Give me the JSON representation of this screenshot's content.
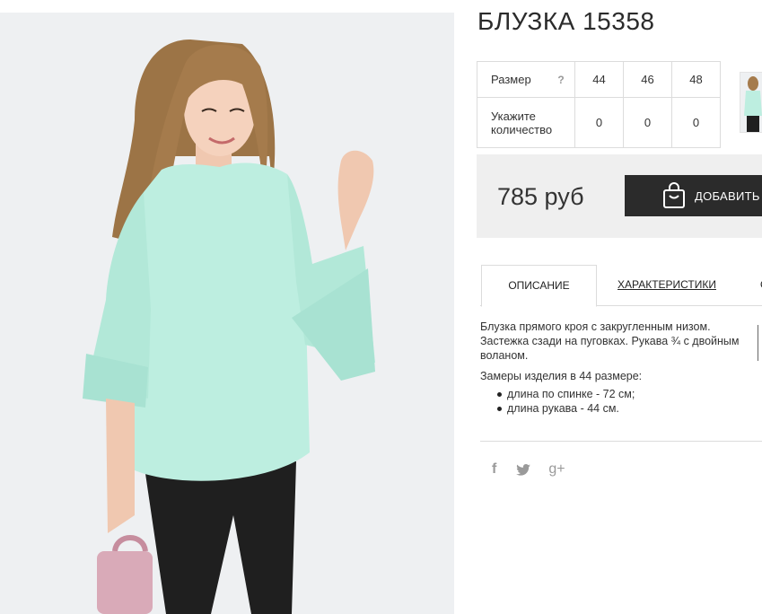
{
  "product": {
    "title": "БЛУЗКА 15358",
    "price": "785 руб",
    "add_button_label": "ДОБАВИТЬ"
  },
  "size_table": {
    "size_label": "Размер",
    "help_symbol": "?",
    "sizes": [
      "44",
      "46",
      "48"
    ],
    "qty_label_line1": "Укажите",
    "qty_label_line2": "количество",
    "quantities": [
      "0",
      "0",
      "0"
    ]
  },
  "tabs": [
    {
      "label": "ОПИСАНИЕ",
      "active": true
    },
    {
      "label": "ХАРАКТЕРИСТИКИ",
      "active": false
    },
    {
      "label": "О",
      "active": false
    }
  ],
  "description": {
    "paragraph": "Блузка прямого кроя с закругленным низом. Застежка сзади на пуговках. Рукава ¾ с двойным воланом.",
    "measurements_title": "Замеры изделия в 44 размере:",
    "measurements": [
      "длина по спинке - 72 см;",
      "длина рукава - 44 см."
    ]
  },
  "social": {
    "facebook": "f",
    "google": "g+"
  },
  "colors": {
    "blouse": "#bdeee0",
    "pants": "#1f1f1f",
    "bag": "#d9aab8",
    "hair": "#9c7446",
    "photo_bg": "#eef0f2",
    "button_bg": "#2b2b2b",
    "price_bg": "#efefef"
  }
}
